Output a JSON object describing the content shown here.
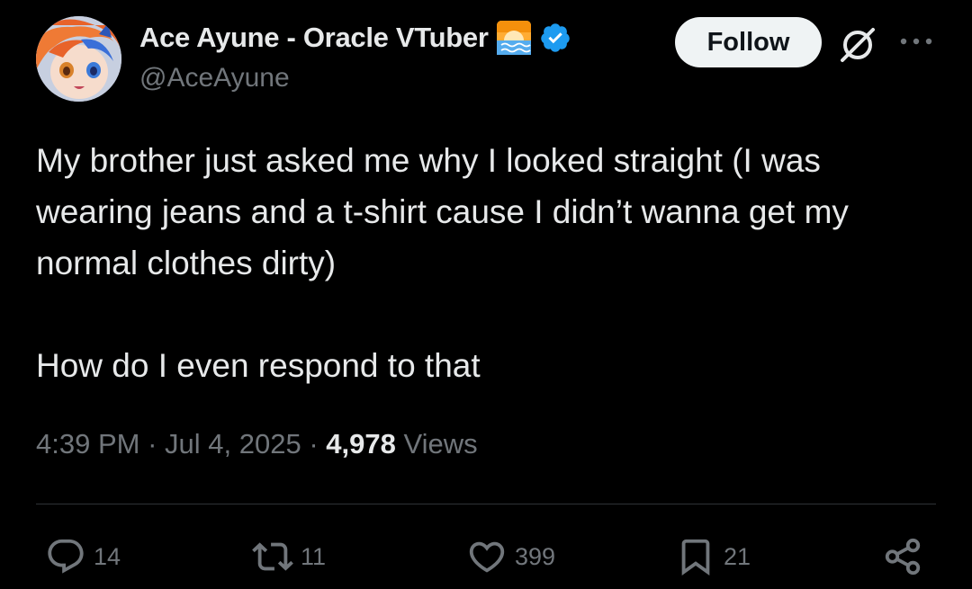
{
  "author": {
    "display_name": "Ace Ayune - Oracle VTuber",
    "handle": "@AceAyune",
    "badge_icons": [
      "sunrise-icon",
      "verified-icon"
    ],
    "verified_color": "#1d9bf0"
  },
  "header": {
    "follow_label": "Follow",
    "icons": [
      "grok-icon",
      "more-icon"
    ]
  },
  "tweet": {
    "paragraphs": [
      "My brother just asked me why I looked straight (I was wearing jeans and a t-shirt cause I didn’t wanna get my normal clothes dirty)",
      "How do I even respond to that"
    ]
  },
  "meta": {
    "time": "4:39 PM",
    "separator": "·",
    "date": "Jul 4, 2025",
    "views_count": "4,978",
    "views_label": "Views"
  },
  "actions": {
    "replies": "14",
    "reposts": "11",
    "likes": "399",
    "bookmarks": "21"
  },
  "colors": {
    "background": "#000000",
    "primary_text": "#e7e9ea",
    "secondary_text": "#71767b",
    "divider": "#2f3336",
    "follow_bg": "#eff3f4"
  }
}
